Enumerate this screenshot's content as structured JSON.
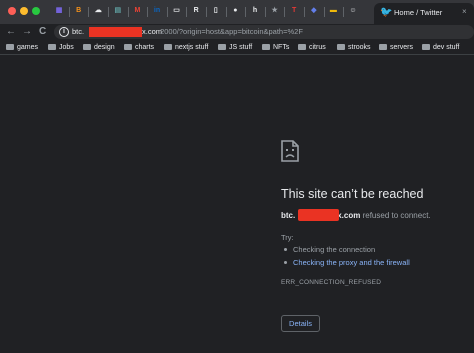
{
  "tabs": {
    "favicons": [
      {
        "name": "tab-favicon-1",
        "glyph": "▦",
        "color": "#7b68ee"
      },
      {
        "name": "tab-favicon-2",
        "glyph": "B",
        "color": "#f7931a"
      },
      {
        "name": "tab-favicon-3",
        "glyph": "☁",
        "color": "#e8eaed"
      },
      {
        "name": "tab-favicon-4",
        "glyph": "▤",
        "color": "#5f9ea0"
      },
      {
        "name": "tab-favicon-gmail",
        "glyph": "M",
        "color": "#ea4335"
      },
      {
        "name": "tab-favicon-linkedin",
        "glyph": "in",
        "color": "#0a66c2"
      },
      {
        "name": "tab-favicon-7",
        "glyph": "▭",
        "color": "#e8eaed"
      },
      {
        "name": "tab-favicon-8",
        "glyph": "R",
        "color": "#e8eaed"
      },
      {
        "name": "tab-favicon-9",
        "glyph": "▯",
        "color": "#e8eaed"
      },
      {
        "name": "tab-favicon-github",
        "glyph": "●",
        "color": "#e8eaed"
      },
      {
        "name": "tab-favicon-11",
        "glyph": "h",
        "color": "#e8eaed"
      },
      {
        "name": "tab-favicon-12",
        "glyph": "★",
        "color": "#9aa0a6"
      },
      {
        "name": "tab-favicon-13",
        "glyph": "T",
        "color": "#e53935"
      },
      {
        "name": "tab-favicon-14",
        "glyph": "◆",
        "color": "#627eea"
      },
      {
        "name": "tab-favicon-15",
        "glyph": "▬",
        "color": "#f0b90b"
      },
      {
        "name": "tab-favicon-16",
        "glyph": "☺",
        "color": "#e8eaed"
      }
    ],
    "active": {
      "title": "Home / Twitter",
      "icon": "twitter-bird-icon",
      "close": "×"
    }
  },
  "toolbar": {
    "back": "←",
    "forward": "→",
    "reload": "C",
    "info_glyph": "i",
    "url_host_prefix": "btc.",
    "url_domain_suffix": "x.com",
    "url_rest": ":2000/?origin=host&app=bitcoin&path=%2F",
    "redaction_color": "#ea3323"
  },
  "bookmarks": [
    "games",
    "Jobs",
    "design",
    "charts",
    "nextjs stuff",
    "JS stuff",
    "NFTs",
    "citrus",
    "strooks",
    "servers",
    "dev stuff"
  ],
  "error": {
    "icon": "sad-page-icon",
    "title": "This site can’t be reached",
    "host_prefix": "btc.",
    "host_suffix": "x.com",
    "refused_text": "refused to connect.",
    "try_label": "Try:",
    "suggestion_1": "Checking the connection",
    "suggestion_2": "Checking the proxy and the firewall",
    "error_code": "ERR_CONNECTION_REFUSED",
    "details_label": "Details"
  }
}
